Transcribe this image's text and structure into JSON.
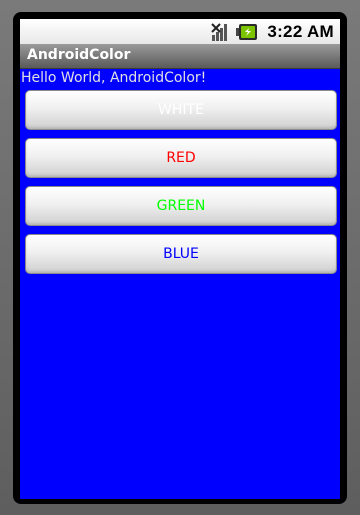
{
  "status_bar": {
    "time": "3:22 AM",
    "icons": [
      "signal-icon",
      "battery-icon"
    ]
  },
  "title_bar": {
    "title": "AndroidColor"
  },
  "content": {
    "hello_text": "Hello World, AndroidColor!",
    "background_color": "#0000ff",
    "buttons": [
      {
        "label": "WHITE",
        "color": "#ffffff"
      },
      {
        "label": "RED",
        "color": "#ff0000"
      },
      {
        "label": "GREEN",
        "color": "#00ff00"
      },
      {
        "label": "BLUE",
        "color": "#0000ff"
      }
    ]
  }
}
